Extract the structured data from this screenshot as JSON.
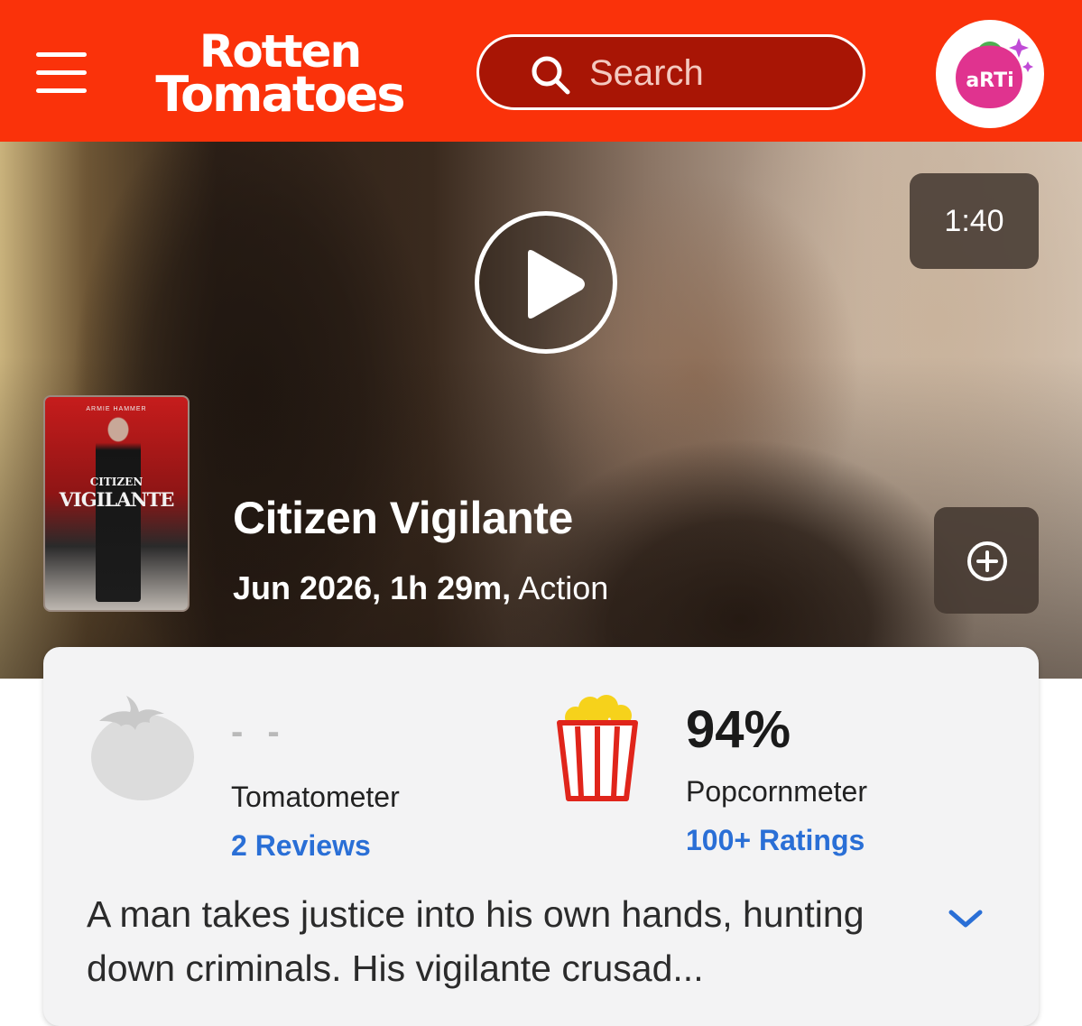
{
  "header": {
    "logo_line1": "Rotten",
    "logo_line2": "Tomatoes",
    "search_placeholder": "Search",
    "avatar_text": "aRTi",
    "colors": {
      "brand": "#fa320a",
      "search_bg": "#a81505"
    }
  },
  "hero": {
    "trailer_duration": "1:40",
    "poster": {
      "top_text": "ARMIE HAMMER",
      "title_line1": "CITIZEN",
      "title_line2": "VIGILANTE"
    },
    "title": "Citizen Vigilante",
    "meta_strong": "Jun 2026, 1h 29m,",
    "genre": "Action",
    "icons": [
      "play-icon",
      "plus-circle-icon",
      "menu-icon",
      "search-icon"
    ]
  },
  "scores": {
    "tomatometer": {
      "score": "- -",
      "label": "Tomatometer",
      "reviews_link": "2 Reviews"
    },
    "popcornmeter": {
      "score": "94%",
      "label": "Popcornmeter",
      "ratings_link": "100+ Ratings"
    },
    "link_color": "#2a6fd6"
  },
  "synopsis": {
    "text": "A man takes justice into his own hands, hunting down criminals. His vigilante crusad..."
  }
}
